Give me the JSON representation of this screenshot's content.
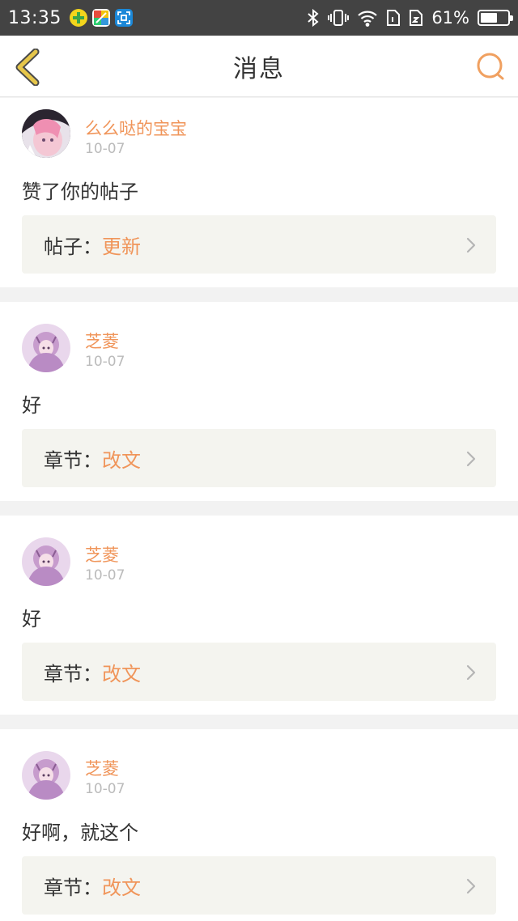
{
  "status_bar": {
    "time": "13:35",
    "battery_percent": "61%",
    "battery_level": 0.61,
    "icons": [
      "app-green-icon",
      "app-colorful-icon",
      "app-scan-icon",
      "bluetooth-icon",
      "vibrate-icon",
      "wifi-icon",
      "sim1-icon",
      "sim2-icon",
      "battery-icon"
    ]
  },
  "header": {
    "title": "消息",
    "back_icon": "chevron-left-icon",
    "search_icon": "search-icon",
    "accent_color": "#f0955a",
    "back_color": "#e6c64a"
  },
  "messages": [
    {
      "user": "么么哒的宝宝",
      "date": "10-07",
      "content": "赞了你的帖子",
      "ref_label": "帖子：",
      "ref_value": "更新"
    },
    {
      "user": "芝菱",
      "date": "10-07",
      "content": "好",
      "ref_label": "章节：",
      "ref_value": "改文"
    },
    {
      "user": "芝菱",
      "date": "10-07",
      "content": "好",
      "ref_label": "章节：",
      "ref_value": "改文"
    },
    {
      "user": "芝菱",
      "date": "10-07",
      "content": "好啊，就这个",
      "ref_label": "章节：",
      "ref_value": "改文"
    }
  ]
}
